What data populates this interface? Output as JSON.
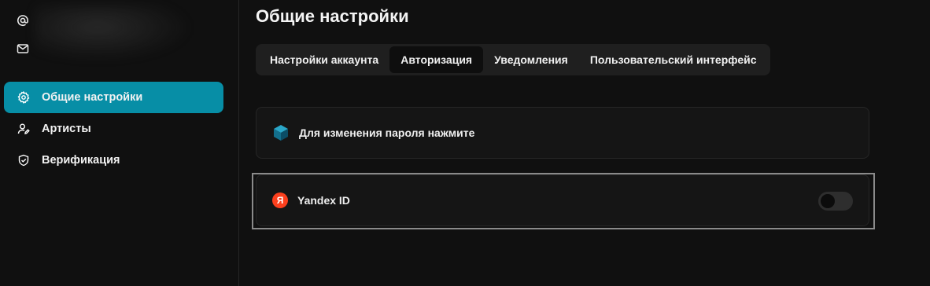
{
  "sidebar": {
    "account_rows": [
      {
        "icon": "at-sign-icon"
      },
      {
        "icon": "mail-icon"
      }
    ],
    "items": [
      {
        "label": "Общие настройки",
        "icon": "settings-gear-icon",
        "active": true
      },
      {
        "label": "Артисты",
        "icon": "user-edit-icon",
        "active": false
      },
      {
        "label": "Верификация",
        "icon": "shield-check-icon",
        "active": false
      }
    ]
  },
  "main": {
    "title": "Общие настройки",
    "tabs": [
      {
        "label": "Настройки аккаунта",
        "active": false
      },
      {
        "label": "Авторизация",
        "active": true
      },
      {
        "label": "Уведомления",
        "active": false
      },
      {
        "label": "Пользовательский интерфейс",
        "active": false
      }
    ],
    "password_card": {
      "label": "Для изменения пароля нажмите",
      "icon": "cube-icon"
    },
    "yandex_card": {
      "label": "Yandex ID",
      "badge": "Я",
      "toggle_on": false
    }
  },
  "colors": {
    "accent": "#078ea6",
    "background": "#101010",
    "yandex_red": "#fc3f1d"
  }
}
